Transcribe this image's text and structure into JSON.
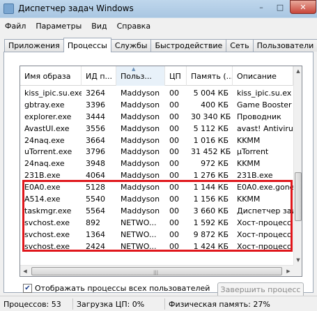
{
  "window": {
    "title": "Диспетчер задач Windows",
    "min": "–",
    "max": "□",
    "close": "✕"
  },
  "menu": [
    "Файл",
    "Параметры",
    "Вид",
    "Справка"
  ],
  "tabs": [
    "Приложения",
    "Процессы",
    "Службы",
    "Быстродействие",
    "Сеть",
    "Пользователи"
  ],
  "active_tab": "Процессы",
  "columns": [
    "Имя образа",
    "ИД п...",
    "Польз...",
    "ЦП",
    "Память (...",
    "Описание"
  ],
  "rows": [
    {
      "name": "kiss_ipic.su.exe",
      "pid": "3264",
      "user": "Maddyson",
      "cpu": "00",
      "mem": "5 004 КБ",
      "desc": "kiss_ipic.su.ex"
    },
    {
      "name": "gbtray.exe",
      "pid": "3396",
      "user": "Maddyson",
      "cpu": "00",
      "mem": "400 КБ",
      "desc": "Game Booster"
    },
    {
      "name": "explorer.exe",
      "pid": "3444",
      "user": "Maddyson",
      "cpu": "00",
      "mem": "30 340 КБ",
      "desc": "Проводник"
    },
    {
      "name": "AvastUI.exe",
      "pid": "3556",
      "user": "Maddyson",
      "cpu": "00",
      "mem": "5 112 КБ",
      "desc": "avast! Antivirus"
    },
    {
      "name": "24naq.exe",
      "pid": "3664",
      "user": "Maddyson",
      "cpu": "00",
      "mem": "1 016 КБ",
      "desc": "KKMM"
    },
    {
      "name": "uTorrent.exe",
      "pid": "3796",
      "user": "Maddyson",
      "cpu": "00",
      "mem": "31 452 КБ",
      "desc": "µTorrent"
    },
    {
      "name": "24naq.exe",
      "pid": "3948",
      "user": "Maddyson",
      "cpu": "00",
      "mem": "972 КБ",
      "desc": "KKMM"
    },
    {
      "name": "231B.exe",
      "pid": "4064",
      "user": "Maddyson",
      "cpu": "00",
      "mem": "1 276 КБ",
      "desc": "231B.exe"
    },
    {
      "name": "E0A0.exe",
      "pid": "5128",
      "user": "Maddyson",
      "cpu": "00",
      "mem": "1 144 КБ",
      "desc": "E0A0.exe.gone"
    },
    {
      "name": "A514.exe",
      "pid": "5540",
      "user": "Maddyson",
      "cpu": "00",
      "mem": "1 156 КБ",
      "desc": "KKMM"
    },
    {
      "name": "taskmgr.exe",
      "pid": "5564",
      "user": "Maddyson",
      "cpu": "00",
      "mem": "3 660 КБ",
      "desc": "Диспетчер задач"
    },
    {
      "name": "svchost.exe",
      "pid": "892",
      "user": "NETWO...",
      "cpu": "00",
      "mem": "1 592 КБ",
      "desc": "Хост-процесс д"
    },
    {
      "name": "svchost.exe",
      "pid": "1364",
      "user": "NETWO...",
      "cpu": "00",
      "mem": "9 872 КБ",
      "desc": "Хост-процесс д"
    },
    {
      "name": "svchost.exe",
      "pid": "2424",
      "user": "NETWO...",
      "cpu": "00",
      "mem": "1 424 КБ",
      "desc": "Хост-процесс д"
    },
    {
      "name": "",
      "pid": "",
      "user": "",
      "cpu": "",
      "mem": "",
      "desc": ""
    }
  ],
  "show_all_users": {
    "label": "Отображать процессы всех пользователей",
    "checked": true
  },
  "end_process_button": "Завершить процесс",
  "status": {
    "processes": "Процессов: 53",
    "cpu": "Загрузка ЦП: 0%",
    "memory": "Физическая память: 27%"
  },
  "colors": {
    "highlight": "#e0161b",
    "title_bg": "#bfd7ec",
    "close_btn": "#c8453a"
  }
}
